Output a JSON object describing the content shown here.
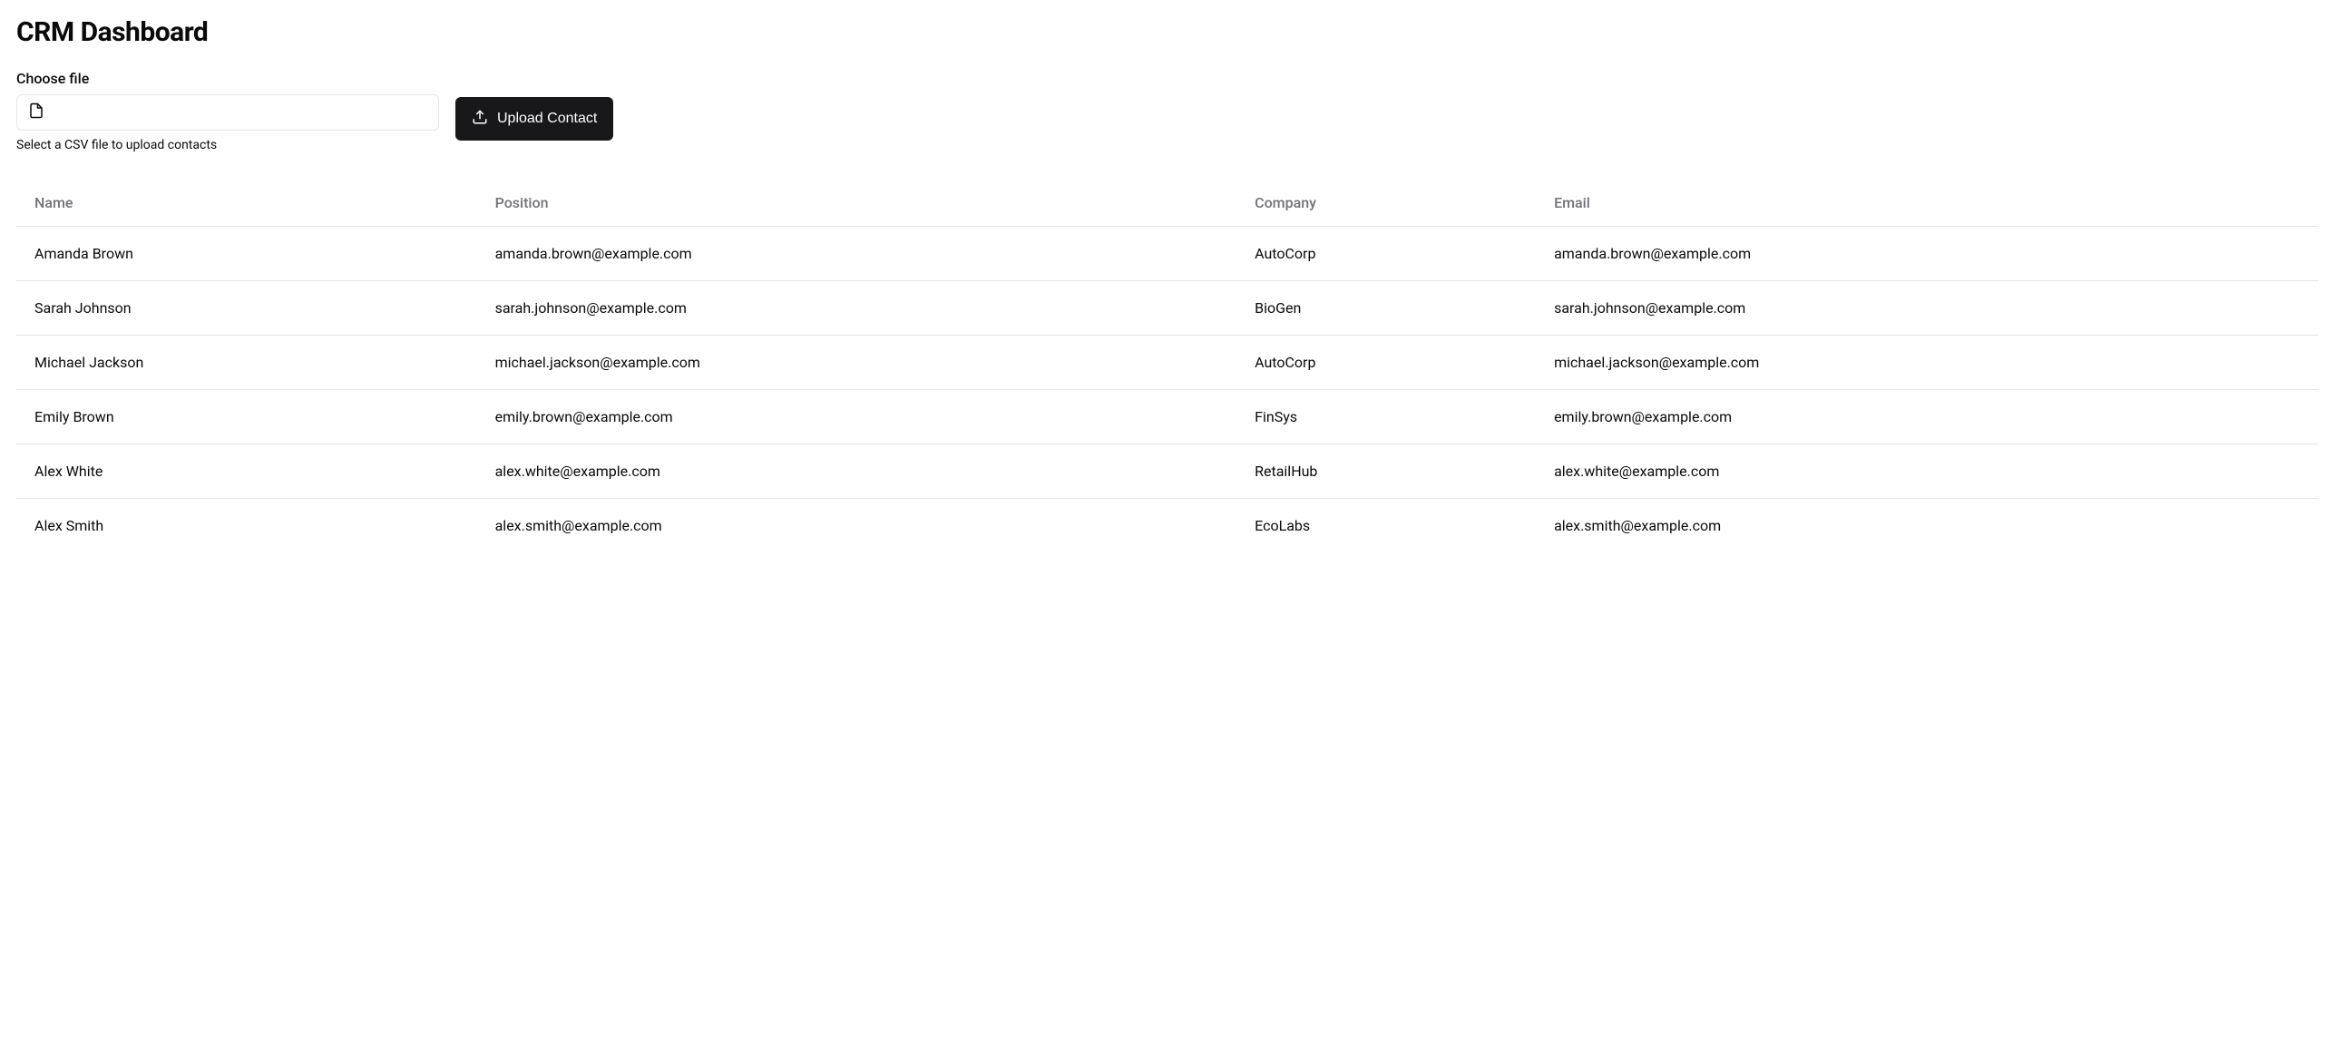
{
  "page": {
    "title": "CRM Dashboard"
  },
  "upload": {
    "file_label": "Choose file",
    "helper_text": "Select a CSV file to upload contacts",
    "button_label": "Upload Contact"
  },
  "table": {
    "headers": {
      "name": "Name",
      "position": "Position",
      "company": "Company",
      "email": "Email"
    },
    "rows": [
      {
        "name": "Amanda Brown",
        "position": "amanda.brown@example.com",
        "company": "AutoCorp",
        "email": "amanda.brown@example.com"
      },
      {
        "name": "Sarah Johnson",
        "position": "sarah.johnson@example.com",
        "company": "BioGen",
        "email": "sarah.johnson@example.com"
      },
      {
        "name": "Michael Jackson",
        "position": "michael.jackson@example.com",
        "company": "AutoCorp",
        "email": "michael.jackson@example.com"
      },
      {
        "name": "Emily Brown",
        "position": "emily.brown@example.com",
        "company": "FinSys",
        "email": "emily.brown@example.com"
      },
      {
        "name": "Alex White",
        "position": "alex.white@example.com",
        "company": "RetailHub",
        "email": "alex.white@example.com"
      },
      {
        "name": "Alex Smith",
        "position": "alex.smith@example.com",
        "company": "EcoLabs",
        "email": "alex.smith@example.com"
      }
    ]
  }
}
